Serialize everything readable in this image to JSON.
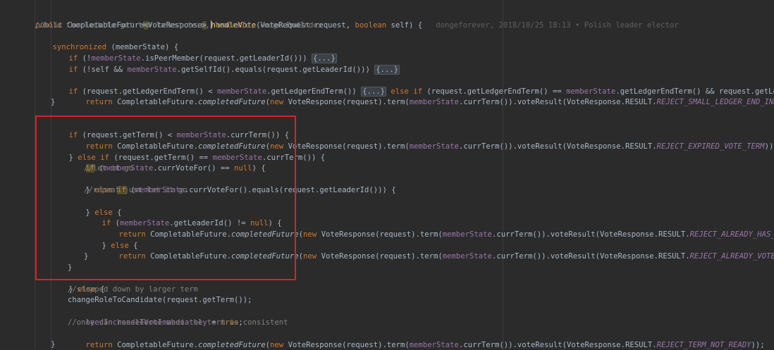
{
  "code": {
    "l1": {
      "k1": "public ",
      "t1": "CompletableFuture",
      "b1": "<",
      "t2": "VoteResponse",
      "b2": ">",
      "sp": " ",
      "m": "handleVote",
      "p1": "(VoteRequest request, ",
      "k2": "boolean",
      "p2": " self) {",
      "blame": "dongeforever, 2018/10/25 18:13 • Polish leader elector"
    },
    "l2": "//hold the lock to get the latest term, leaderId, ledgerEndIndex",
    "l3": {
      "k": "synchronized",
      "r": " (memberState) {"
    },
    "l4": {
      "k": "if",
      "a": " (!",
      "f": "memberState",
      "b": ".isPeerMember(request.getLeaderId())) ",
      "fold": "{...}"
    },
    "l5": {
      "k": "if",
      "a": " (!self && ",
      "f": "memberState",
      "b": ".getSelfId().equals(request.getLeaderId())) ",
      "fold": "{...}"
    },
    "l7": {
      "k": "if",
      "a": " (request.getLedgerEndTerm() < ",
      "f1": "memberState",
      "b": ".getLedgerEndTerm()) ",
      "fold": "{...}",
      "k2": " else if",
      "c": " (request.getLedgerEndTerm() == ",
      "f2": "memberState",
      "d": ".getLedgerEndTerm() && request.getLedgerEndIndex() <"
    },
    "l8": {
      "k": "return",
      "a": " CompletableFuture.",
      "m": "completedFuture",
      "b": "(",
      "k2": "new",
      "c": " VoteResponse(request).term(",
      "f": "memberState",
      "d": ".currTerm()).voteResult(VoteResponse.RESULT.",
      "e": "REJECT_SMALL_LEDGER_END_INDEX",
      "g": "));"
    },
    "l9": "}",
    "l11": {
      "k": "if",
      "a": " (request.getTerm() < ",
      "f": "memberState",
      "b": ".currTerm()) {"
    },
    "l12": {
      "k": "return",
      "a": " CompletableFuture.",
      "m": "completedFuture",
      "b": "(",
      "k2": "new",
      "c": " VoteResponse(request).term(",
      "f": "memberState",
      "d": ".currTerm()).voteResult(VoteResponse.RESULT.",
      "e": "REJECT_EXPIRED_VOTE_TERM",
      "g": "));"
    },
    "l13": {
      "a": "} ",
      "k": "else if",
      "b": " (request.getTerm() == ",
      "f": "memberState",
      "c": ".currTerm()) {"
    },
    "l14": {
      "k": "if",
      "a": " (",
      "f": "memberState",
      "b": ".currVoteFor() == ",
      "k2": "null",
      "c": ") {"
    },
    "l15": "//let it go",
    "l16": {
      "a": "} ",
      "k1": "else ",
      "k2": "if",
      "b": " (",
      "f": "memberState",
      "c": ".currVoteFor().equals(request.getLeaderId())) {"
    },
    "l17": "//repeat just let it go",
    "l18": {
      "a": "} ",
      "k": "else",
      "b": " {"
    },
    "l19": {
      "k": "if",
      "a": " (",
      "f": "memberState",
      "b": ".getLeaderId() != ",
      "k2": "null",
      "c": ") {"
    },
    "l20": {
      "k": "return",
      "a": " CompletableFuture.",
      "m": "completedFuture",
      "b": "(",
      "k2": "new",
      "c": " VoteResponse(request).term(",
      "f": "memberState",
      "d": ".currTerm()).voteResult(VoteResponse.RESULT.",
      "e": "REJECT_ALREADY_HAS_LEADER",
      "g": "));"
    },
    "l21": {
      "a": "} ",
      "k": "else",
      "b": " {"
    },
    "l22": {
      "k": "return",
      "a": " CompletableFuture.",
      "m": "completedFuture",
      "b": "(",
      "k2": "new",
      "c": " VoteResponse(request).term(",
      "f": "memberState",
      "d": ".currTerm()).voteResult(VoteResponse.RESULT.",
      "e": "REJECT_ALREADY_VOTED",
      "g": "));"
    },
    "l23": "}",
    "l24": "}",
    "l25": {
      "a": "} ",
      "k": "else",
      "b": " {"
    },
    "l26": "//stepped down by larger term",
    "l27": "changeRoleToCandidate(request.getTerm());",
    "l28": {
      "f": "needIncreaseTermImmediately",
      "a": " = ",
      "k": "true",
      "b": ";"
    },
    "l29": "//only can handleVote when the term is consistent",
    "l30": {
      "k": "return",
      "a": " CompletableFuture.",
      "m": "completedFuture",
      "b": "(",
      "k2": "new",
      "c": " VoteResponse(request).term(",
      "f": "memberState",
      "d": ".currTerm()).voteResult(VoteResponse.RESULT.",
      "e": "REJECT_TERM_NOT_READY",
      "g": "));"
    },
    "l31": "}"
  },
  "colors": {
    "background": "#2b2b2b",
    "keyword": "#cc7832",
    "field": "#9876aa",
    "comment": "#808080",
    "text": "#a9b7c6",
    "highlight_box": "#e21e21"
  }
}
